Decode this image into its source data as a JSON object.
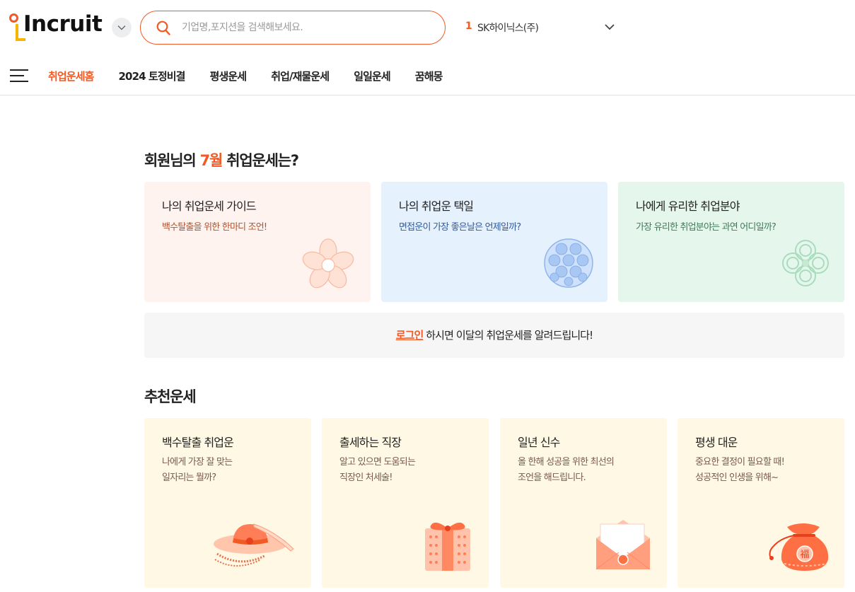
{
  "header": {
    "logo_text": "Incruit",
    "search_placeholder": "기업명,포지션을 검색해보세요.",
    "trending_rank": "1",
    "trending_keyword": "SK하이닉스(주)"
  },
  "nav": {
    "items": [
      {
        "label": "취업운세홈",
        "active": true
      },
      {
        "label": "2024 토정비결"
      },
      {
        "label": "평생운세"
      },
      {
        "label": "취업/재물운세"
      },
      {
        "label": "일일운세"
      },
      {
        "label": "꿈해몽"
      }
    ]
  },
  "fortune_section": {
    "title_prefix": "회원님의 ",
    "title_month": "7월",
    "title_suffix": " 취업운세는?",
    "cards": [
      {
        "title": "나의 취업운세 가이드",
        "desc": "백수탈출을 위한 한마디 조언!",
        "icon": "flower-icon",
        "bg": "#fff3f0",
        "desc_color": "#b1532f"
      },
      {
        "title": "나의 취업운 택일",
        "desc": "면접운이 가장 좋은날은 언제일까?",
        "icon": "coin-pattern-icon",
        "bg": "#e6f1fe",
        "desc_color": "#2f5aa0"
      },
      {
        "title": "나에게 유리한 취업분야",
        "desc": "가장 유리한 취업분야는 과연 어디일까?",
        "icon": "knot-icon",
        "bg": "#e5f7ec",
        "desc_color": "#3f7a5a"
      }
    ]
  },
  "login_banner": {
    "link": "로그인",
    "text": " 하시면 이달의 취업운세를 알려드립니다!"
  },
  "recommend_section": {
    "title": "추천운세",
    "cards": [
      {
        "title": "백수탈출 취업운",
        "desc1": "나에게 가장 잘 맞는",
        "desc2": "일자리는 뭘까?",
        "icon": "hat-icon"
      },
      {
        "title": "출세하는 직장",
        "desc1": "알고 있으면 도움되는",
        "desc2": "직장인 처세술!",
        "icon": "gift-box-icon"
      },
      {
        "title": "일년 신수",
        "desc1": "올 한해 성공을 위한 최선의",
        "desc2": "조언을 해드립니다.",
        "icon": "envelope-icon"
      },
      {
        "title": "평생 대운",
        "desc1": "중요한 결정이 필요할 때!",
        "desc2": "성공적인 인생을 위해~",
        "icon": "lucky-pouch-icon",
        "pouch_char": "福"
      }
    ]
  },
  "colors": {
    "accent": "#f15a24",
    "logo_yellow": "#f7b500"
  }
}
